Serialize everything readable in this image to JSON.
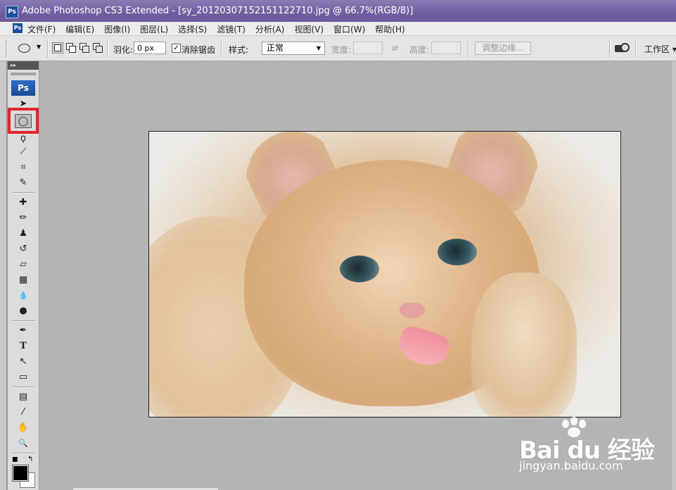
{
  "window": {
    "app_icon": "Ps",
    "title": "Adobe Photoshop CS3 Extended - [sy_20120307152151122710.jpg @ 66.7%(RGB/8)]"
  },
  "menubar": {
    "items": [
      "文件(F)",
      "编辑(E)",
      "图像(I)",
      "图层(L)",
      "选择(S)",
      "滤镜(T)",
      "分析(A)",
      "视图(V)",
      "窗口(W)",
      "帮助(H)"
    ]
  },
  "options": {
    "feather_label": "羽化:",
    "feather_value": "0 px",
    "antialias_label": "消除锯齿",
    "antialias_checked": true,
    "style_label": "样式:",
    "style_value": "正常",
    "width_label": "宽度:",
    "height_label": "高度:",
    "refine_edge_label": "调整边缘...",
    "workspace_label": "工作区",
    "workspace_caret": "▾"
  },
  "toolbox": {
    "logo": "Ps",
    "collapse_glyph": "▸▸",
    "selected_tool": "elliptical-marquee",
    "tools": [
      {
        "name": "move-tool-icon",
        "glyph": "➤"
      },
      {
        "name": "elliptical-marquee-tool-icon",
        "glyph": "◯"
      },
      {
        "name": "lasso-tool-icon",
        "glyph": "ϙ"
      },
      {
        "name": "magic-wand-tool-icon",
        "glyph": "⟋"
      },
      {
        "name": "crop-tool-icon",
        "glyph": "⌗"
      },
      {
        "name": "slice-tool-icon",
        "glyph": "✎"
      },
      {
        "name": "healing-brush-tool-icon",
        "glyph": "✚"
      },
      {
        "name": "brush-tool-icon",
        "glyph": "✏"
      },
      {
        "name": "clone-stamp-tool-icon",
        "glyph": "♟"
      },
      {
        "name": "history-brush-tool-icon",
        "glyph": "↺"
      },
      {
        "name": "eraser-tool-icon",
        "glyph": "▱"
      },
      {
        "name": "gradient-tool-icon",
        "glyph": "▦"
      },
      {
        "name": "blur-tool-icon",
        "glyph": "💧"
      },
      {
        "name": "dodge-tool-icon",
        "glyph": "●"
      },
      {
        "name": "pen-tool-icon",
        "glyph": "✒"
      },
      {
        "name": "type-tool-icon",
        "glyph": "T"
      },
      {
        "name": "path-selection-tool-icon",
        "glyph": "↖"
      },
      {
        "name": "rectangle-tool-icon",
        "glyph": "▭"
      },
      {
        "name": "notes-tool-icon",
        "glyph": "▤"
      },
      {
        "name": "eyedropper-tool-icon",
        "glyph": "⁄"
      },
      {
        "name": "hand-tool-icon",
        "glyph": "✋"
      },
      {
        "name": "zoom-tool-icon",
        "glyph": "🔍"
      }
    ],
    "foreground_color": "#000000",
    "background_color": "#ffffff",
    "highlight_color": "#e3262a"
  },
  "document": {
    "filename": "sy_20120307152151122710.jpg",
    "zoom": "66.7%",
    "mode": "RGB/8",
    "image_subject": "kitten"
  },
  "watermark": {
    "brand": "Bai du 经验",
    "url": "jingyan.baidu.com"
  }
}
